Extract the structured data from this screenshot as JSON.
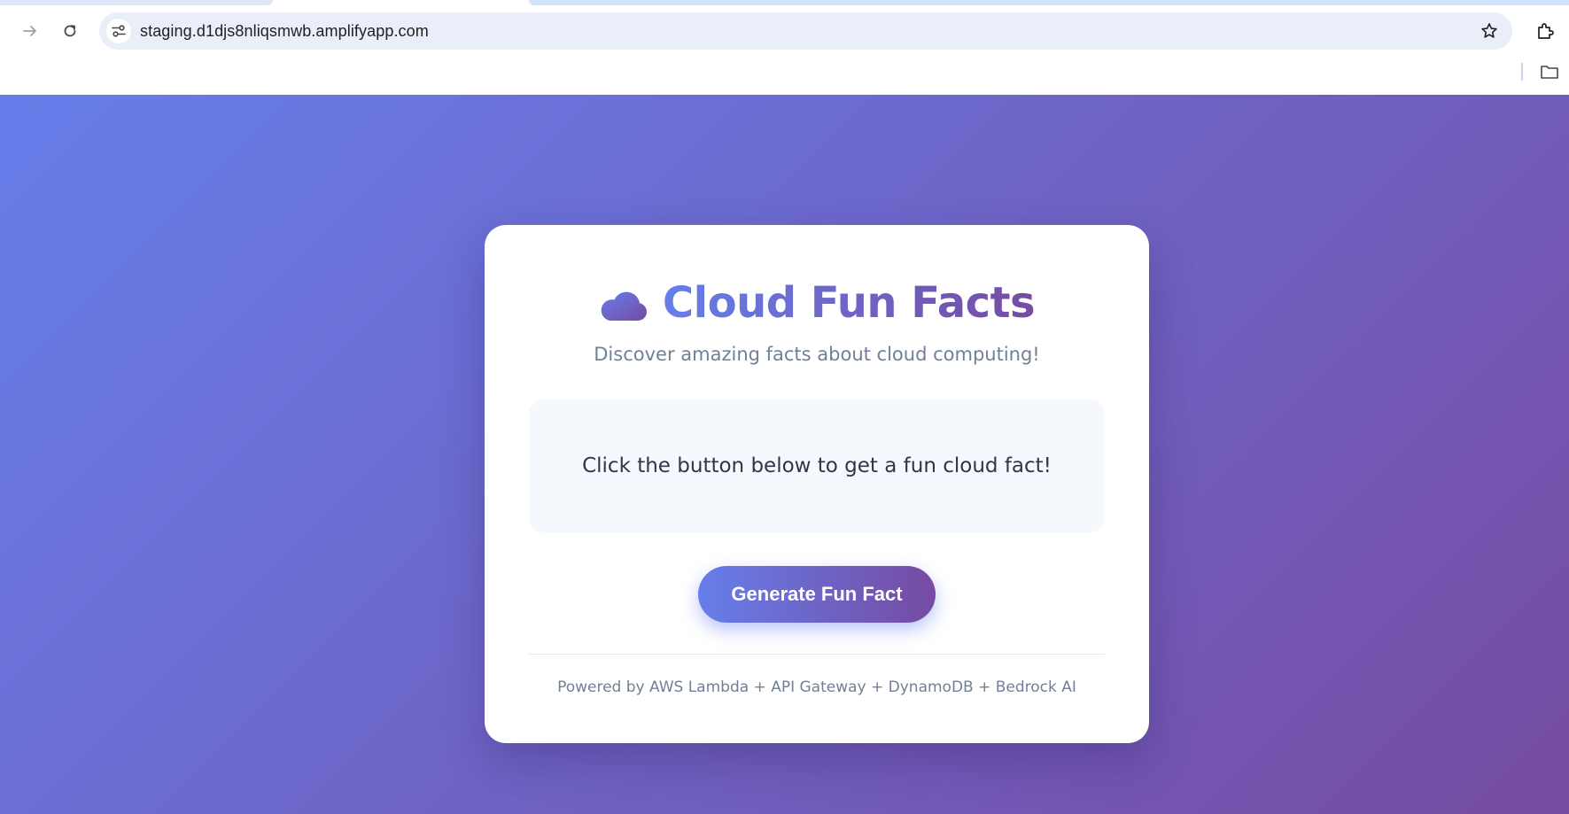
{
  "browser": {
    "url": "staging.d1djs8nliqsmwb.amplifyapp.com",
    "icons": {
      "forward": "arrow-forward-icon",
      "reload": "reload-icon",
      "site_info": "tune-icon",
      "bookmark": "star-icon",
      "extensions": "puzzle-icon",
      "bookmarks_folder": "folder-icon"
    }
  },
  "app": {
    "title": "Cloud Fun Facts",
    "title_icon": "cloud-icon",
    "subtitle": "Discover amazing facts about cloud computing!",
    "fact_text": "Click the button below to get a fun cloud fact!",
    "button_label": "Generate Fun Fact",
    "footer": "Powered by AWS Lambda + API Gateway + DynamoDB + Bedrock AI"
  },
  "colors": {
    "gradient_start": "#667eea",
    "gradient_end": "#764ba2",
    "card_background": "#ffffff",
    "fact_box_background": "#f5f8fc",
    "muted_text": "#718096",
    "body_text": "#2d3748"
  }
}
